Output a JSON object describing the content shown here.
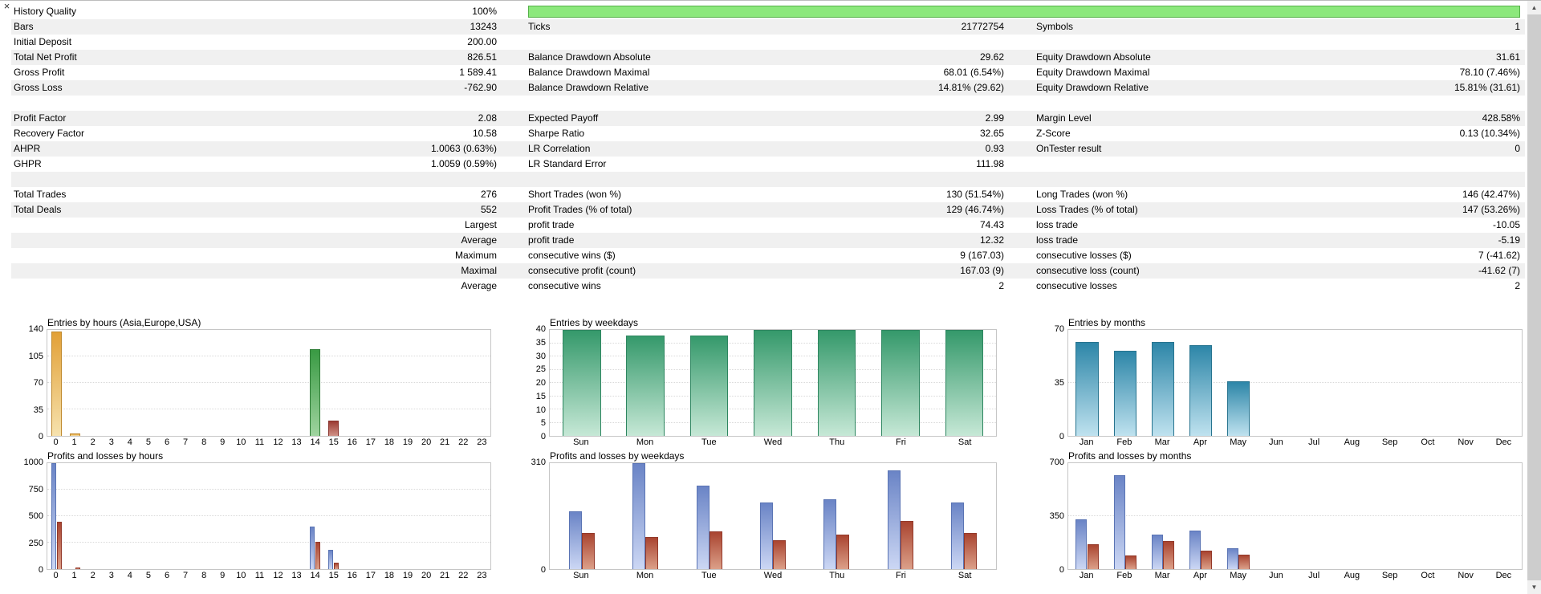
{
  "icons": {
    "close": "×",
    "scroll_up": "▲",
    "scroll_down": "▼"
  },
  "stats": {
    "rows": [
      {
        "c1l": "History Quality",
        "c1v": "100%",
        "progress": true
      },
      {
        "c1l": "Bars",
        "c1v": "13243",
        "c2l": "Ticks",
        "c2v": "21772754",
        "c3l": "Symbols",
        "c3v": "1"
      },
      {
        "c1l": "Initial Deposit",
        "c1v": "200.00",
        "c2l": "",
        "c2v": "",
        "c3l": "",
        "c3v": ""
      },
      {
        "c1l": "Total Net Profit",
        "c1v": "826.51",
        "c2l": "Balance Drawdown Absolute",
        "c2v": "29.62",
        "c3l": "Equity Drawdown Absolute",
        "c3v": "31.61"
      },
      {
        "c1l": "Gross Profit",
        "c1v": "1 589.41",
        "c2l": "Balance Drawdown Maximal",
        "c2v": "68.01 (6.54%)",
        "c3l": "Equity Drawdown Maximal",
        "c3v": "78.10 (7.46%)"
      },
      {
        "c1l": "Gross Loss",
        "c1v": "-762.90",
        "c2l": "Balance Drawdown Relative",
        "c2v": "14.81% (29.62)",
        "c3l": "Equity Drawdown Relative",
        "c3v": "15.81% (31.61)"
      },
      {
        "c1l": "",
        "c1v": "",
        "c2l": "",
        "c2v": "",
        "c3l": "",
        "c3v": ""
      },
      {
        "c1l": "Profit Factor",
        "c1v": "2.08",
        "c2l": "Expected Payoff",
        "c2v": "2.99",
        "c3l": "Margin Level",
        "c3v": "428.58%"
      },
      {
        "c1l": "Recovery Factor",
        "c1v": "10.58",
        "c2l": "Sharpe Ratio",
        "c2v": "32.65",
        "c3l": "Z-Score",
        "c3v": "0.13 (10.34%)"
      },
      {
        "c1l": "AHPR",
        "c1v": "1.0063 (0.63%)",
        "c2l": "LR Correlation",
        "c2v": "0.93",
        "c3l": "OnTester result",
        "c3v": "0"
      },
      {
        "c1l": "GHPR",
        "c1v": "1.0059 (0.59%)",
        "c2l": "LR Standard Error",
        "c2v": "111.98",
        "c3l": "",
        "c3v": ""
      },
      {
        "c1l": "",
        "c1v": "",
        "c2l": "",
        "c2v": "",
        "c3l": "",
        "c3v": ""
      },
      {
        "c1l": "Total Trades",
        "c1v": "276",
        "c2l": "Short Trades (won %)",
        "c2v": "130 (51.54%)",
        "c3l": "Long Trades (won %)",
        "c3v": "146 (42.47%)"
      },
      {
        "c1l": "Total Deals",
        "c1v": "552",
        "c2l": "Profit Trades (% of total)",
        "c2v": "129 (46.74%)",
        "c3l": "Loss Trades (% of total)",
        "c3v": "147 (53.26%)"
      },
      {
        "c1l": "",
        "c1v": "Largest",
        "c2l": "profit trade",
        "c2v": "74.43",
        "c3l": "loss trade",
        "c3v": "-10.05"
      },
      {
        "c1l": "",
        "c1v": "Average",
        "c2l": "profit trade",
        "c2v": "12.32",
        "c3l": "loss trade",
        "c3v": "-5.19"
      },
      {
        "c1l": "",
        "c1v": "Maximum",
        "c2l": "consecutive wins ($)",
        "c2v": "9 (167.03)",
        "c3l": "consecutive losses ($)",
        "c3v": "7 (-41.62)"
      },
      {
        "c1l": "",
        "c1v": "Maximal",
        "c2l": "consecutive profit (count)",
        "c2v": "167.03 (9)",
        "c3l": "consecutive loss (count)",
        "c3v": "-41.62 (7)"
      },
      {
        "c1l": "",
        "c1v": "Average",
        "c2l": "consecutive wins",
        "c2v": "2",
        "c3l": "consecutive losses",
        "c3v": "2"
      }
    ]
  },
  "palette": {
    "orange": {
      "top": "#e2a036",
      "bottom": "#f6e2ae",
      "border": "#c08a2e"
    },
    "green": {
      "top": "#399a43",
      "bottom": "#9fd49f",
      "border": "#2f7d37"
    },
    "darkred": {
      "top": "#9c3b33",
      "bottom": "#cf9186",
      "border": "#87312b"
    },
    "weekgreen": {
      "top": "#35996b",
      "bottom": "#c6e8d6",
      "border": "#2e8660"
    },
    "months_blue": {
      "top": "#2d86a8",
      "bottom": "#bfe2ef",
      "border": "#27748f"
    },
    "profit_blue": {
      "top": "#6a84c6",
      "bottom": "#ccd7f4",
      "border": "#5a74b4"
    },
    "loss_red": {
      "top": "#a94430",
      "bottom": "#dca089",
      "border": "#93392a"
    }
  },
  "chart_data": [
    {
      "id": "entries-by-hours",
      "type": "bar",
      "title": "Entries by hours (Asia,Europe,USA)",
      "categories": [
        "0",
        "1",
        "2",
        "3",
        "4",
        "5",
        "6",
        "7",
        "8",
        "9",
        "10",
        "11",
        "12",
        "13",
        "14",
        "15",
        "16",
        "17",
        "18",
        "19",
        "20",
        "21",
        "22",
        "23"
      ],
      "ymax": 140,
      "yticks": [
        0,
        35,
        70,
        105,
        140
      ],
      "series": [
        {
          "name": "entries",
          "values": [
            138,
            3,
            0,
            0,
            0,
            0,
            0,
            0,
            0,
            0,
            0,
            0,
            0,
            0,
            115,
            20,
            0,
            0,
            0,
            0,
            0,
            0,
            0,
            0
          ],
          "colors": [
            "orange",
            "orange",
            "",
            "",
            "",
            "",
            "",
            "",
            "",
            "",
            "",
            "",
            "",
            "",
            "green",
            "darkred",
            "",
            "",
            "",
            "",
            "",
            "",
            "",
            ""
          ]
        }
      ]
    },
    {
      "id": "entries-by-weekdays",
      "type": "bar",
      "title": "Entries by weekdays",
      "categories": [
        "Sun",
        "Mon",
        "Tue",
        "Wed",
        "Thu",
        "Fri",
        "Sat"
      ],
      "ymax": 40,
      "yticks": [
        0,
        5,
        10,
        15,
        20,
        25,
        30,
        35,
        40
      ],
      "series": [
        {
          "name": "entries",
          "color": "weekgreen",
          "values": [
            40,
            38,
            38,
            40,
            40,
            40,
            40
          ]
        }
      ]
    },
    {
      "id": "entries-by-months",
      "type": "bar",
      "title": "Entries by months",
      "categories": [
        "Jan",
        "Feb",
        "Mar",
        "Apr",
        "May",
        "Jun",
        "Jul",
        "Aug",
        "Sep",
        "Oct",
        "Nov",
        "Dec"
      ],
      "ymax": 70,
      "yticks": [
        0,
        35,
        70
      ],
      "series": [
        {
          "name": "entries",
          "color": "months_blue",
          "values": [
            62,
            56,
            62,
            60,
            36,
            0,
            0,
            0,
            0,
            0,
            0,
            0
          ]
        }
      ]
    },
    {
      "id": "profits-losses-by-hours",
      "type": "bar",
      "title": "Profits and losses by hours",
      "categories": [
        "0",
        "1",
        "2",
        "3",
        "4",
        "5",
        "6",
        "7",
        "8",
        "9",
        "10",
        "11",
        "12",
        "13",
        "14",
        "15",
        "16",
        "17",
        "18",
        "19",
        "20",
        "21",
        "22",
        "23"
      ],
      "ymax": 1000,
      "yticks": [
        0,
        250,
        500,
        750,
        1000
      ],
      "series": [
        {
          "name": "profits",
          "color": "profit_blue",
          "values": [
            1000,
            0,
            0,
            0,
            0,
            0,
            0,
            0,
            0,
            0,
            0,
            0,
            0,
            0,
            400,
            180,
            0,
            0,
            0,
            0,
            0,
            0,
            0,
            0
          ]
        },
        {
          "name": "losses",
          "color": "loss_red",
          "values": [
            450,
            15,
            0,
            0,
            0,
            0,
            0,
            0,
            0,
            0,
            0,
            0,
            0,
            0,
            260,
            60,
            0,
            0,
            0,
            0,
            0,
            0,
            0,
            0
          ]
        }
      ]
    },
    {
      "id": "profits-losses-by-weekdays",
      "type": "bar",
      "title": "Profits and losses by weekdays",
      "categories": [
        "Sun",
        "Mon",
        "Tue",
        "Wed",
        "Thu",
        "Fri",
        "Sat"
      ],
      "ymax": 310,
      "yticks": [
        0,
        310
      ],
      "series": [
        {
          "name": "profits",
          "color": "profit_blue",
          "values": [
            170,
            310,
            245,
            195,
            205,
            290,
            195
          ]
        },
        {
          "name": "losses",
          "color": "loss_red",
          "values": [
            105,
            95,
            110,
            85,
            100,
            140,
            105
          ]
        }
      ]
    },
    {
      "id": "profits-losses-by-months",
      "type": "bar",
      "title": "Profits and losses by months",
      "categories": [
        "Jan",
        "Feb",
        "Mar",
        "Apr",
        "May",
        "Jun",
        "Jul",
        "Aug",
        "Sep",
        "Oct",
        "Nov",
        "Dec"
      ],
      "ymax": 700,
      "yticks": [
        0,
        350,
        700
      ],
      "series": [
        {
          "name": "profits",
          "color": "profit_blue",
          "values": [
            330,
            620,
            230,
            255,
            140,
            0,
            0,
            0,
            0,
            0,
            0,
            0
          ]
        },
        {
          "name": "losses",
          "color": "loss_red",
          "values": [
            165,
            90,
            185,
            120,
            95,
            0,
            0,
            0,
            0,
            0,
            0,
            0
          ]
        }
      ]
    }
  ]
}
